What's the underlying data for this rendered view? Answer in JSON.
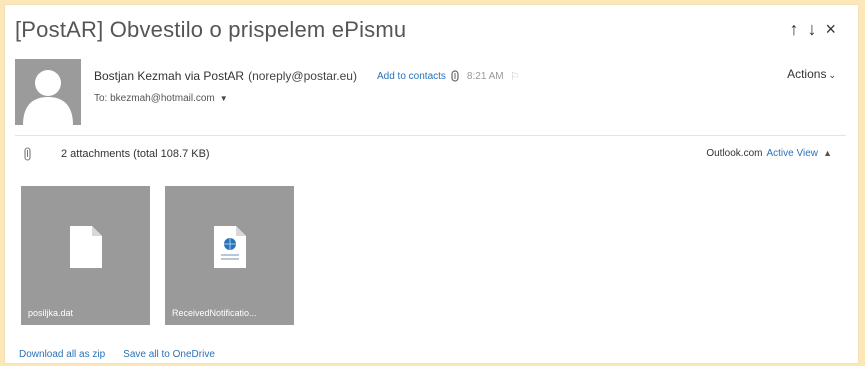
{
  "message": {
    "subject": "[PostAR] Obvestilo o prispelem ePismu",
    "sender_name": "Bostjan Kezmah via PostAR",
    "sender_email": "(noreply@postar.eu)",
    "add_to_contacts": "Add to contacts",
    "time": "8:21 AM",
    "to_line": "To: bkezmah@hotmail.com",
    "actions_label": "Actions"
  },
  "nav": {
    "up": "↑",
    "down": "↓",
    "close": "×"
  },
  "attachments": {
    "summary": "2 attachments (total 108.7 KB)",
    "view_label": "Outlook.com",
    "active_view_label": "Active View",
    "files": [
      {
        "name": "posiljka.dat",
        "icon": "blank-document-icon"
      },
      {
        "name": "ReceivedNotificatio...",
        "icon": "web-document-icon"
      }
    ],
    "download_all": "Download all as zip",
    "save_all": "Save all to OneDrive"
  },
  "colors": {
    "link": "#2a72b8",
    "tile": "#9a9a9a",
    "frame_border": "#fde7b6"
  }
}
